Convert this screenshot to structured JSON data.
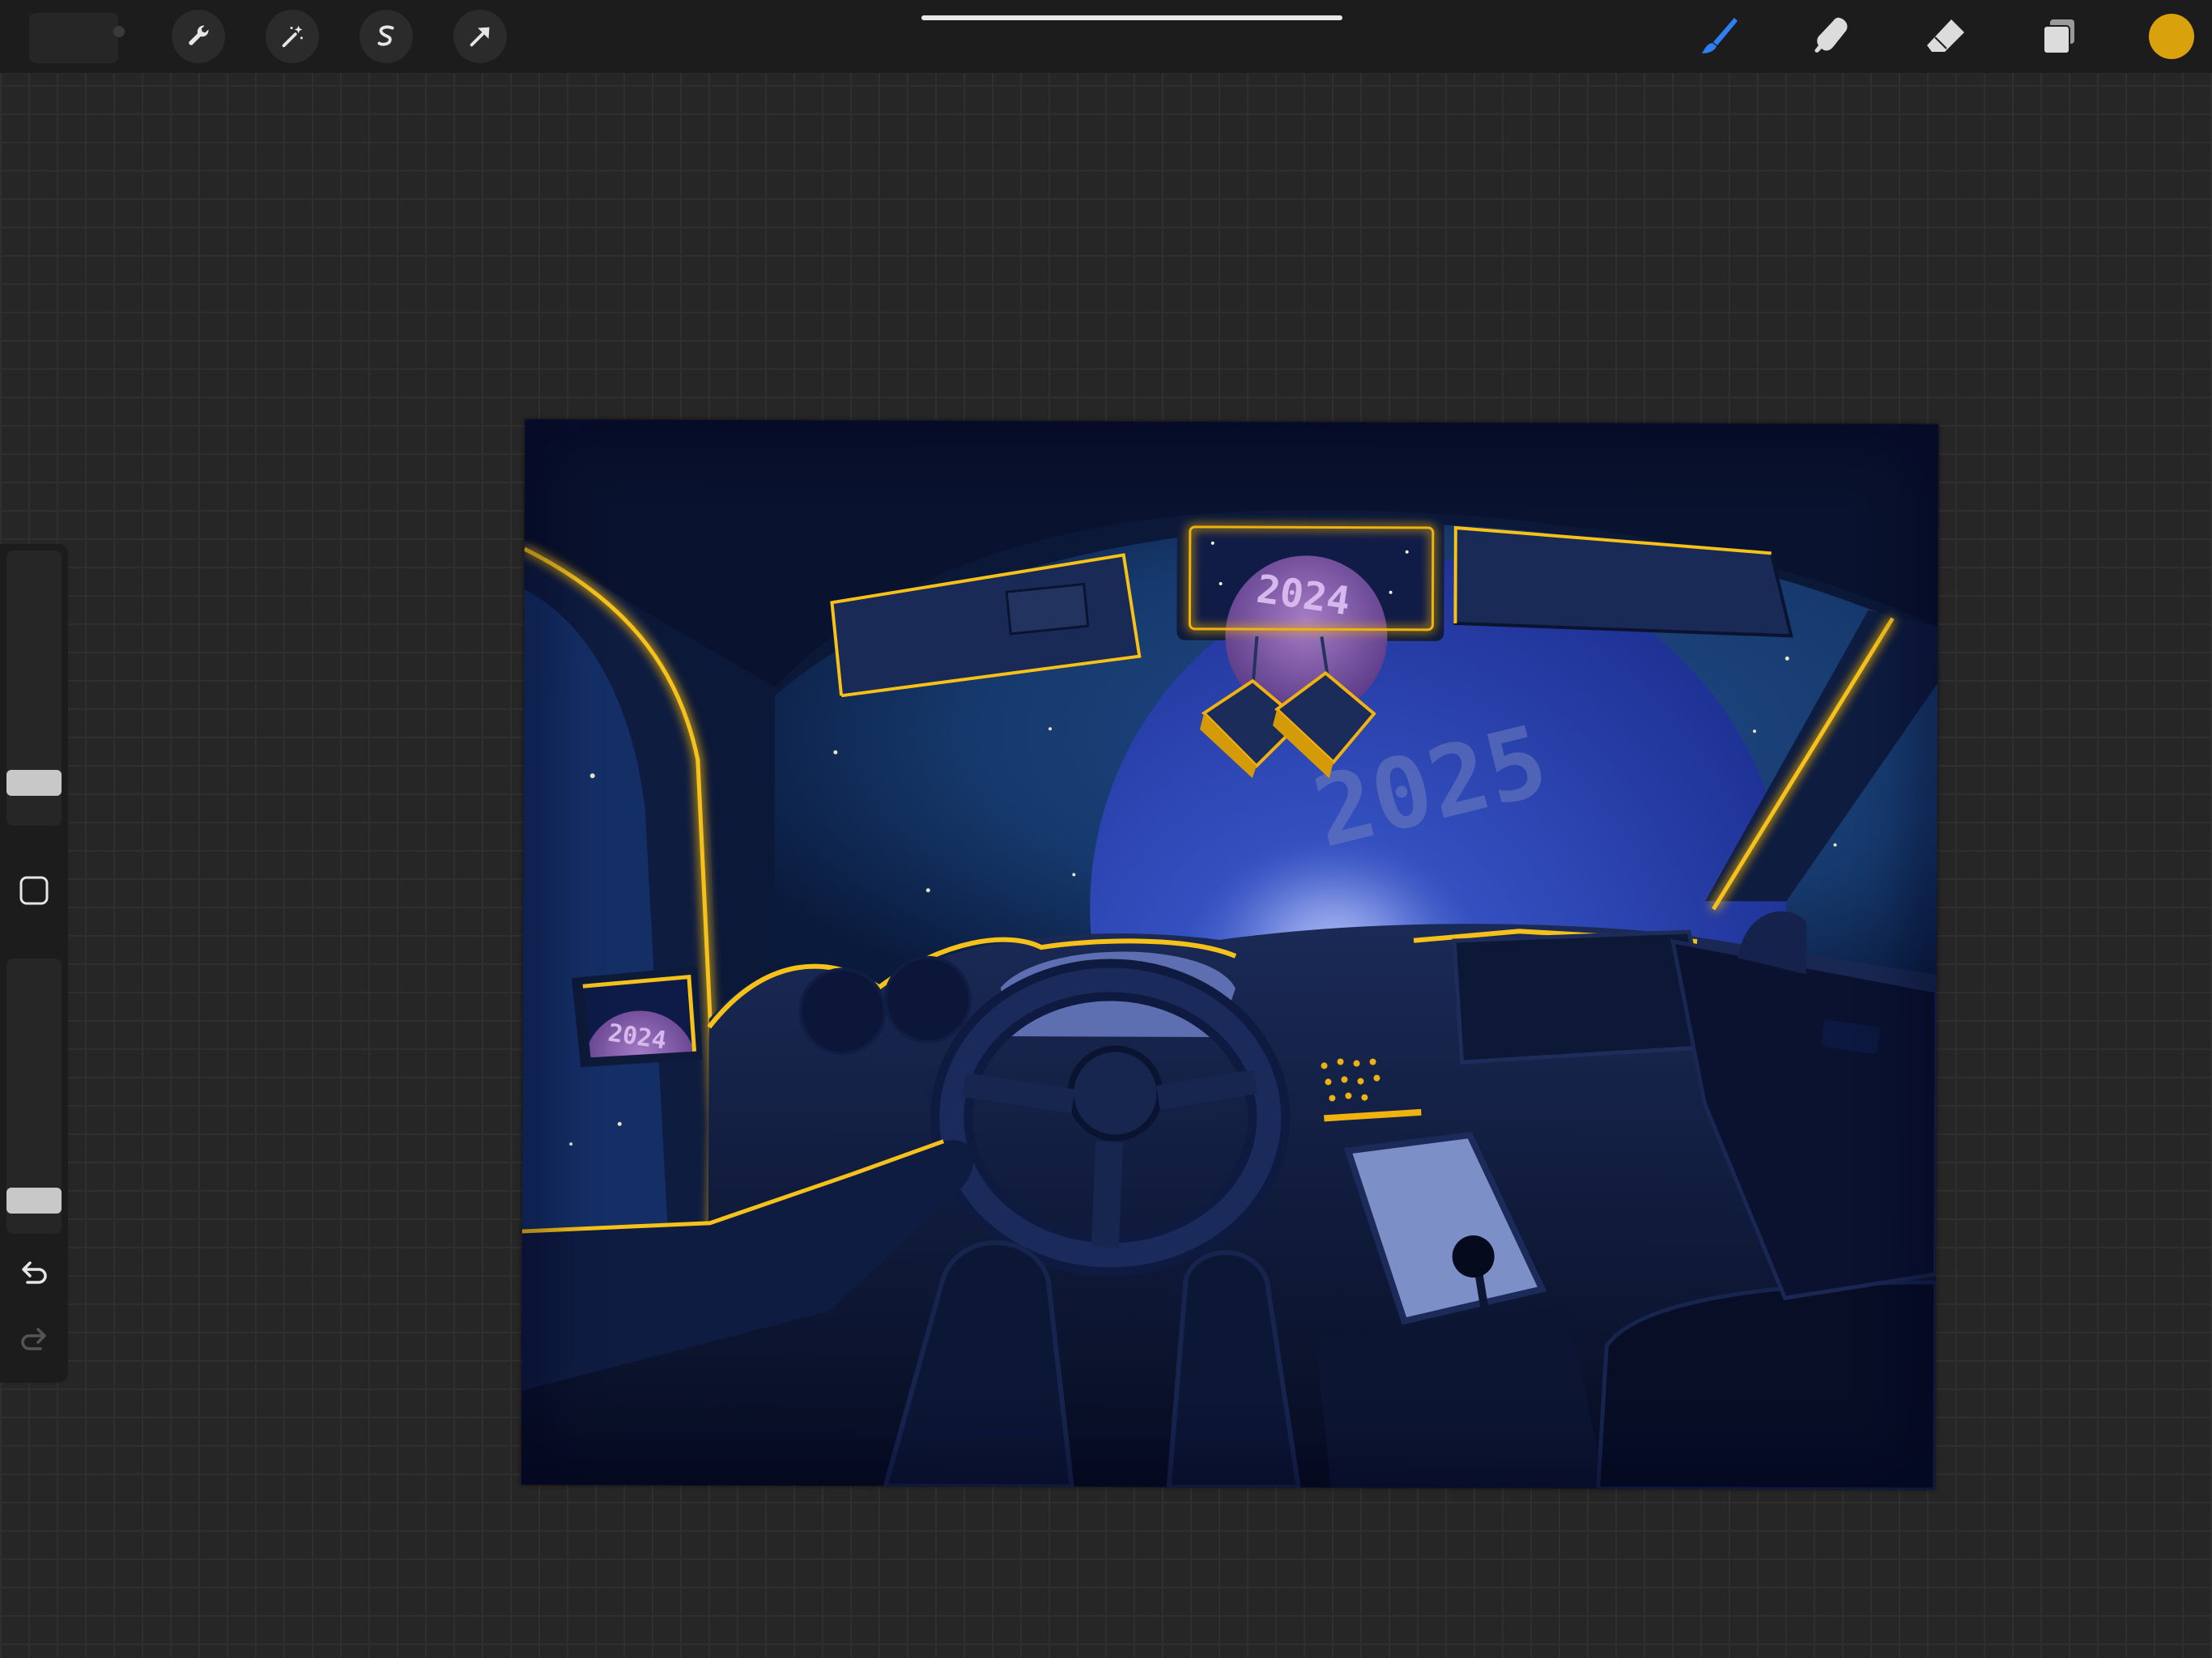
{
  "app": {
    "name": "Procreate"
  },
  "toolbar_left": {
    "items": [
      {
        "name": "actions",
        "icon": "wrench-icon"
      },
      {
        "name": "adjustments",
        "icon": "magic-wand-icon"
      },
      {
        "name": "selection",
        "icon": "selection-s-icon"
      },
      {
        "name": "transform",
        "icon": "arrow-cursor-icon"
      }
    ]
  },
  "toolbar_right": {
    "items": [
      {
        "name": "brush",
        "icon": "brush-icon",
        "active": true
      },
      {
        "name": "smudge",
        "icon": "smudge-finger-icon",
        "active": false
      },
      {
        "name": "eraser",
        "icon": "eraser-icon",
        "active": false
      },
      {
        "name": "layers",
        "icon": "layers-icon",
        "active": false
      }
    ],
    "current_color": "#d9a10b"
  },
  "sidebar": {
    "brush_size_level": 0.12,
    "opacity_level": 0.08,
    "modify_icon": "square-modify-icon",
    "undo_icon": "undo-arrow-icon",
    "redo_icon": "redo-arrow-icon",
    "redo_enabled": false
  },
  "artwork": {
    "title_number_main": "2025",
    "title_number_mirror": "2024",
    "title_number_side": "2024",
    "accent_color": "#f0b20e",
    "sky_color": "#1a3f78",
    "planet_color": "#2a44a8",
    "small_planet_color": "#8c5aa8"
  }
}
